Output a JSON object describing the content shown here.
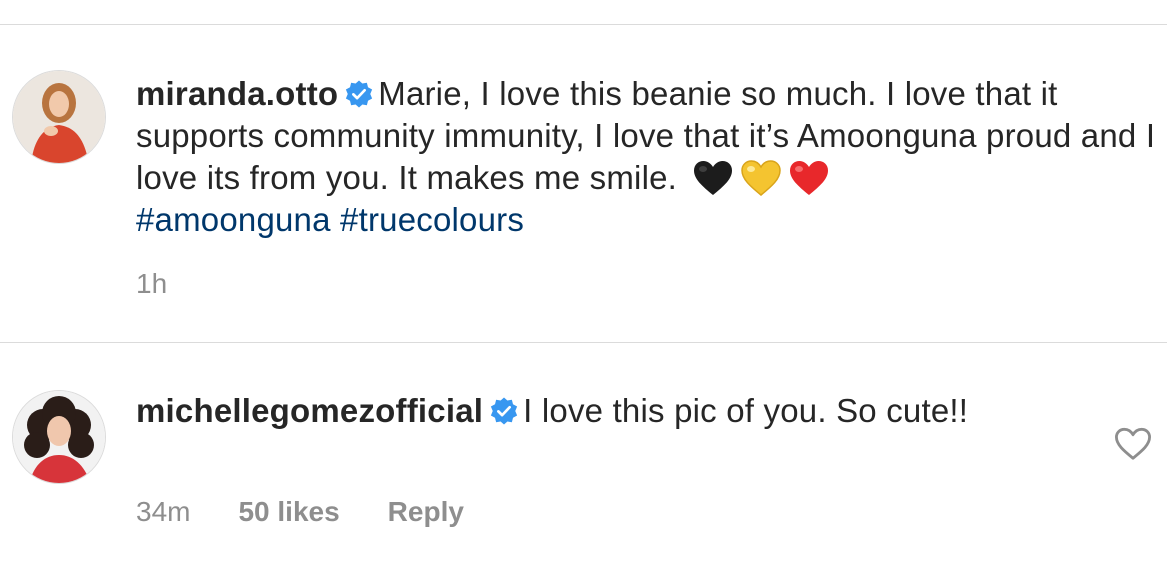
{
  "comments": [
    {
      "username": "miranda.otto",
      "verified": true,
      "text": "Marie, I love this beanie so much. I love that it supports community immunity, I love that it’s Amoonguna proud and I love its from you. It makes me smile.",
      "emojis": [
        "black-heart",
        "yellow-heart",
        "red-heart"
      ],
      "hashtags": [
        "#amoonguna",
        "#truecolours"
      ],
      "time": "1h"
    },
    {
      "username": "michellegomezofficial",
      "verified": true,
      "text": "I love this pic of you. So cute!!",
      "time": "34m",
      "likes": "50 likes",
      "reply_label": "Reply",
      "like_icon": "heart-outline-icon"
    }
  ],
  "colors": {
    "text": "#262626",
    "muted": "#8e8e8e",
    "hashtag": "#00376b",
    "verified": "#3897f0",
    "divider": "#dbdbdb"
  }
}
